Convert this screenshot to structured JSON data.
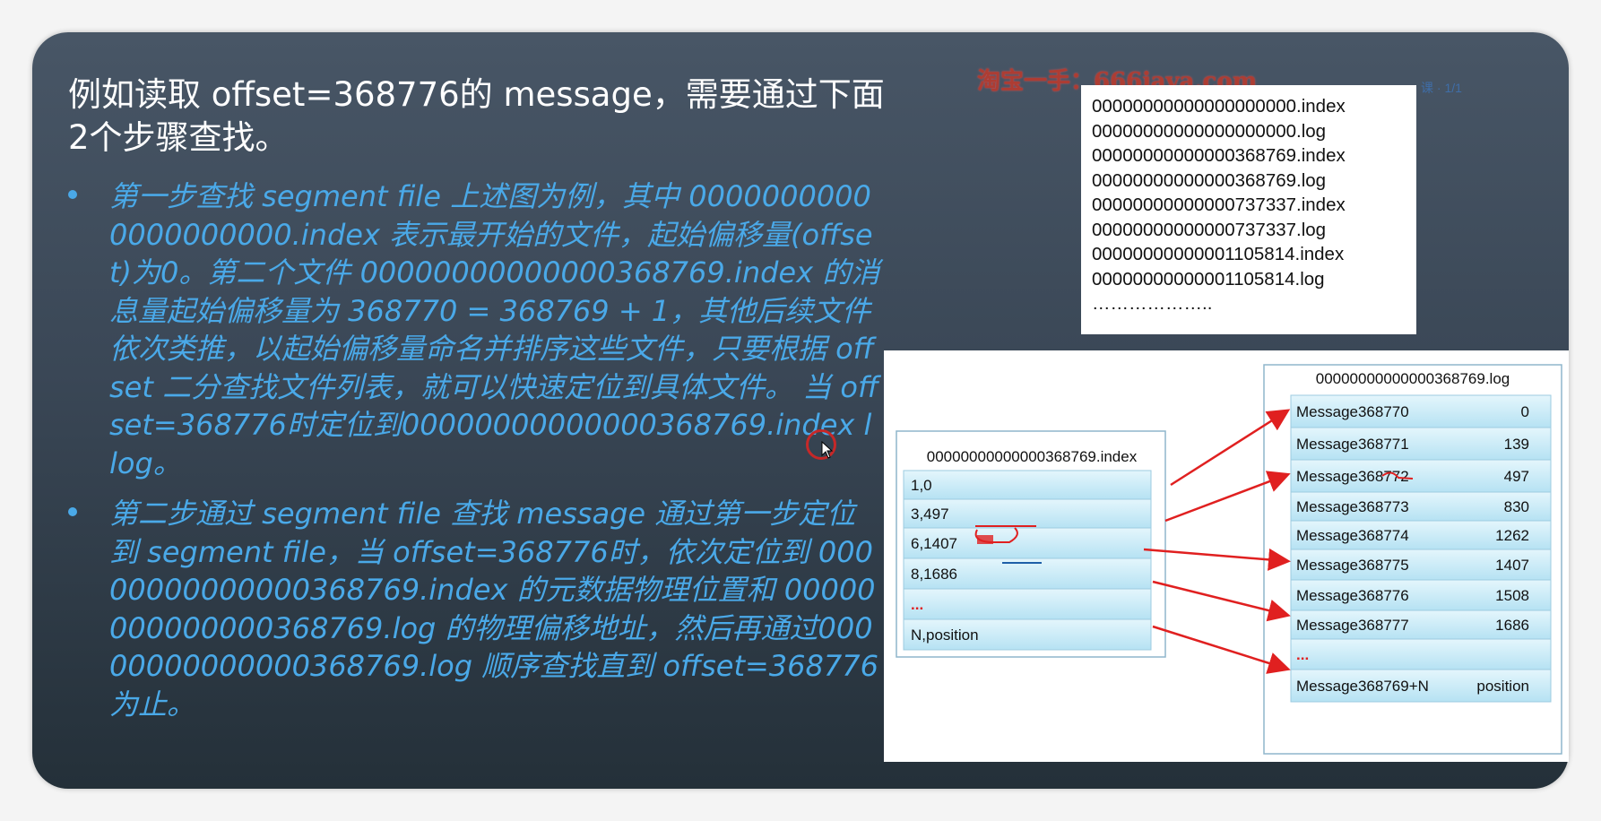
{
  "title": "例如读取 offset=368776的 message，需要通过下面2个步骤查找。",
  "bullets": [
    "第一步查找 segment file 上述图为例，其中 00000000000000000000.index 表示最开始的文件，起始偏移量(offset)为0。第二个文件 00000000000000368769.index 的消息量起始偏移量为 368770 = 368769 + 1，其他后续文件依次类推，以起始偏移量命名并排序这些文件，只要根据 offset 二分查找文件列表，就可以快速定位到具体文件。 当 offset=368776时定位到00000000000000368769.index l log。",
    "第二步通过 segment file 查找 message 通过第一步定位到 segment file，当 offset=368776时，依次定位到 00000000000000368769.index 的元数据物理位置和 00000000000000368769.log 的物理偏移地址，然后再通过00000000000000368769.log 顺序查找直到 offset=368776 为止。"
  ],
  "watermark": "淘宝一手：666java.com",
  "corner_mark": "课 · 1/1",
  "file_list": [
    "00000000000000000000.index",
    "00000000000000000000.log",
    "00000000000000368769.index",
    "00000000000000368769.log",
    "00000000000000737337.index",
    "00000000000000737337.log",
    "00000000000001105814.index",
    "00000000000001105814.log",
    "……………….."
  ],
  "index_file": {
    "name": "00000000000000368769.index",
    "rows": [
      "1,0",
      "3,497",
      "6,1407",
      "8,1686",
      "...",
      "N,position"
    ]
  },
  "log_file": {
    "name": "00000000000000368769.log",
    "rows": [
      {
        "message": "Message368770",
        "position": "0"
      },
      {
        "message": "Message368771",
        "position": "139"
      },
      {
        "message": "Message368772",
        "position": "497"
      },
      {
        "message": "Message368773",
        "position": "830"
      },
      {
        "message": "Message368774",
        "position": "1262"
      },
      {
        "message": "Message368775",
        "position": "1407"
      },
      {
        "message": "Message368776",
        "position": "1508"
      },
      {
        "message": "Message368777",
        "position": "1686"
      },
      {
        "message": "...",
        "position": ""
      },
      {
        "message": "Message368769+N",
        "position": "position"
      }
    ]
  },
  "colors": {
    "bullet_text": "#4aa9e8",
    "cell_fill": "#c9ecf8",
    "arrow": "#e02020",
    "ellipsis": "#e02020"
  }
}
